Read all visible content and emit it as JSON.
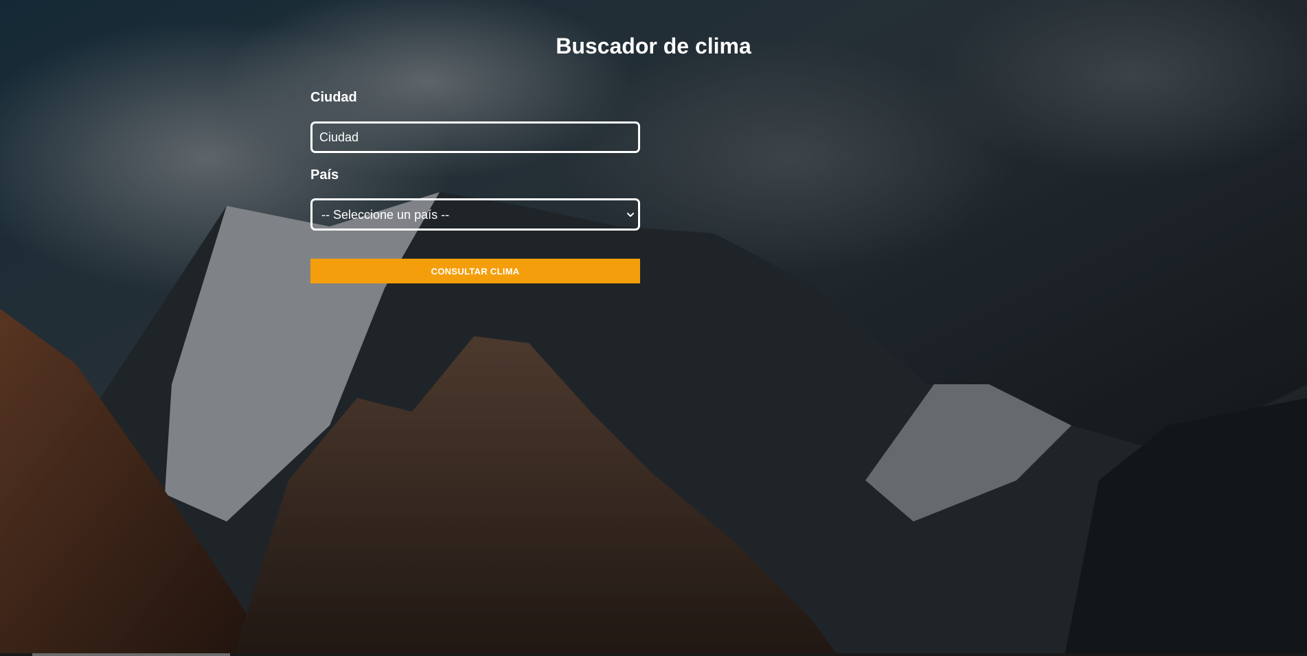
{
  "page": {
    "title": "Buscador de clima"
  },
  "form": {
    "city": {
      "label": "Ciudad",
      "placeholder": "Ciudad",
      "value": ""
    },
    "country": {
      "label": "País",
      "selected": "-- Seleccione un país --"
    },
    "submit_label": "CONSULTAR CLIMA"
  },
  "colors": {
    "accent": "#f59e0b",
    "text": "#ffffff",
    "sky": "#1b2126"
  },
  "icons": {
    "select_arrow": "chevron-down-icon"
  }
}
